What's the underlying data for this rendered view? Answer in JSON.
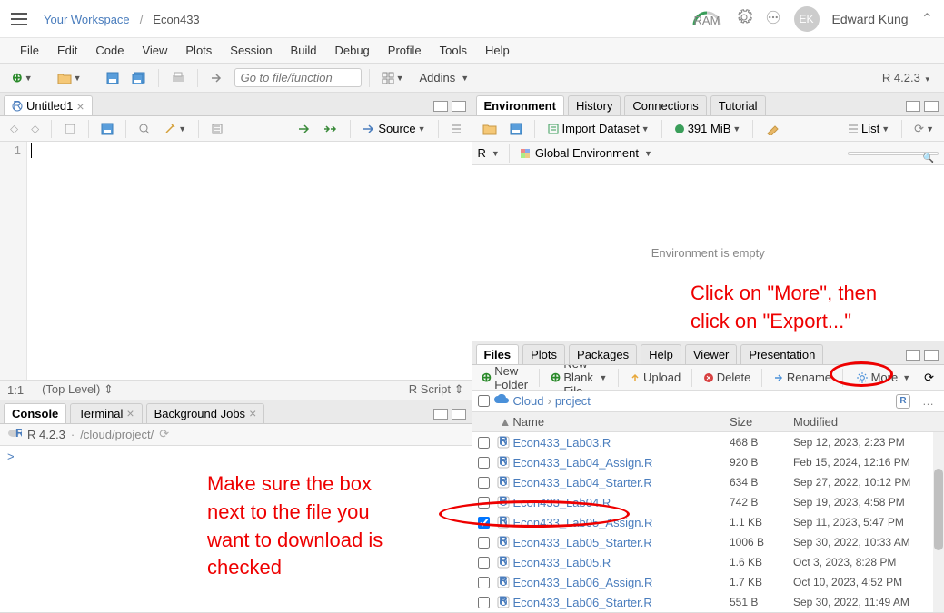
{
  "header": {
    "workspace": "Your Workspace",
    "project": "Econ433",
    "ram_label": "RAM",
    "user_initials": "EK",
    "user_name": "Edward Kung"
  },
  "menubar": [
    "File",
    "Edit",
    "Code",
    "View",
    "Plots",
    "Session",
    "Build",
    "Debug",
    "Profile",
    "Tools",
    "Help"
  ],
  "toolbar": {
    "goto_placeholder": "Go to file/function",
    "addins_label": "Addins",
    "r_version": "R 4.2.3"
  },
  "source_pane": {
    "tab_title": "Untitled1",
    "source_btn": "Source",
    "status_left": "1:1",
    "status_scope": "(Top Level)",
    "status_lang": "R Script",
    "line_number": "1"
  },
  "console_pane": {
    "tabs": [
      "Console",
      "Terminal",
      "Background Jobs"
    ],
    "r_version": "R 4.2.3",
    "path": "/cloud/project/",
    "prompt": ">"
  },
  "env_pane": {
    "tabs": [
      "Environment",
      "History",
      "Connections",
      "Tutorial"
    ],
    "import_label": "Import Dataset",
    "mem_label": "391 MiB",
    "view_label": "List",
    "lang": "R",
    "scope": "Global Environment",
    "empty_msg": "Environment is empty"
  },
  "files_pane": {
    "tabs": [
      "Files",
      "Plots",
      "Packages",
      "Help",
      "Viewer",
      "Presentation"
    ],
    "new_folder": "New Folder",
    "new_blank": "New Blank File",
    "upload": "Upload",
    "delete": "Delete",
    "rename": "Rename",
    "more": "More",
    "crumb_root": "Cloud",
    "crumb_proj": "project",
    "header_name": "Name",
    "header_size": "Size",
    "header_mod": "Modified",
    "files": [
      {
        "checked": false,
        "name": "Econ433_Lab03.R",
        "size": "468 B",
        "modified": "Sep 12, 2023, 2:23 PM"
      },
      {
        "checked": false,
        "name": "Econ433_Lab04_Assign.R",
        "size": "920 B",
        "modified": "Feb 15, 2024, 12:16 PM"
      },
      {
        "checked": false,
        "name": "Econ433_Lab04_Starter.R",
        "size": "634 B",
        "modified": "Sep 27, 2022, 10:12 PM"
      },
      {
        "checked": false,
        "name": "Econ433_Lab04.R",
        "size": "742 B",
        "modified": "Sep 19, 2023, 4:58 PM"
      },
      {
        "checked": true,
        "name": "Econ433_Lab05_Assign.R",
        "size": "1.1 KB",
        "modified": "Sep 11, 2023, 5:47 PM"
      },
      {
        "checked": false,
        "name": "Econ433_Lab05_Starter.R",
        "size": "1006 B",
        "modified": "Sep 30, 2022, 10:33 AM"
      },
      {
        "checked": false,
        "name": "Econ433_Lab05.R",
        "size": "1.6 KB",
        "modified": "Oct 3, 2023, 8:28 PM"
      },
      {
        "checked": false,
        "name": "Econ433_Lab06_Assign.R",
        "size": "1.7 KB",
        "modified": "Oct 10, 2023, 4:52 PM"
      },
      {
        "checked": false,
        "name": "Econ433_Lab06_Starter.R",
        "size": "551 B",
        "modified": "Sep 30, 2022, 11:49 AM"
      }
    ]
  },
  "annotations": {
    "more_text": "Click on \"More\", then\nclick on \"Export...\"",
    "checkbox_text": "Make sure the box\nnext to the file you\nwant to download is\nchecked"
  }
}
